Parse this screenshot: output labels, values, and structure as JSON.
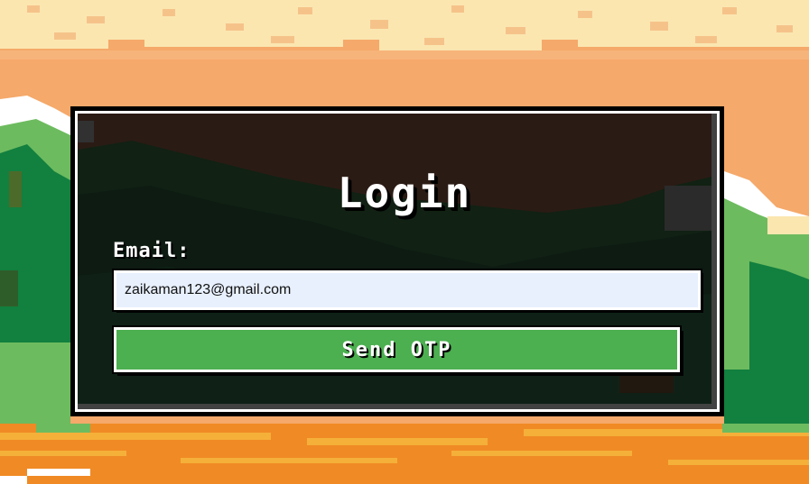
{
  "form": {
    "title": "Login",
    "email_label": "Email:",
    "email_value": "zaikaman123@gmail.com",
    "send_button_label": "Send OTP"
  },
  "colors": {
    "sky": "#f5a96a",
    "sand": "#f08a24",
    "grass": "#6dbb5f",
    "forest": "#12803f",
    "button": "#4caf50",
    "input_bg": "#e8f0fe"
  }
}
